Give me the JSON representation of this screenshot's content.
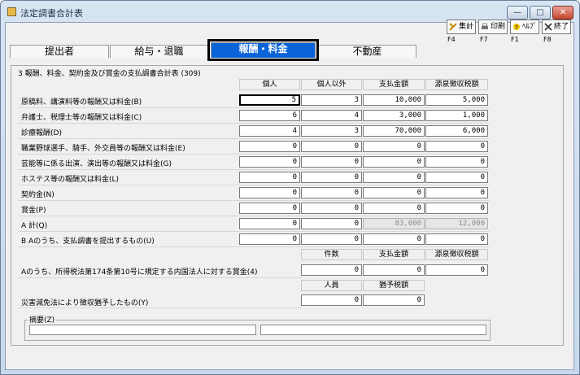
{
  "window": {
    "title": "法定調書合計表",
    "min": "—",
    "max": "□",
    "close": "✕"
  },
  "toolbar": [
    {
      "label": "集計",
      "fkey": "F4",
      "icon": "sum-icon"
    },
    {
      "label": "印刷",
      "fkey": "F7",
      "icon": "printer-icon"
    },
    {
      "label": "ﾍﾙﾌﾟ",
      "fkey": "F1",
      "icon": "help-icon"
    },
    {
      "label": "終了",
      "fkey": "F8",
      "icon": "exit-icon"
    }
  ],
  "tabs": [
    "提出者",
    "給与・退職",
    "報酬・料金",
    "不動産"
  ],
  "active_tab": "報酬・料金",
  "section_title": "3 報酬、料金、契約金及び賞金の支払調書合計表 (309)",
  "headers": [
    "個人",
    "個人以外",
    "支払金額",
    "源泉徴収税額"
  ],
  "rows": [
    {
      "label": "原稿料、講演料等の報酬又は料金(B)",
      "values": [
        "5",
        "3",
        "10,000",
        "5,000"
      ]
    },
    {
      "label": "弁護士、税理士等の報酬又は料金(C)",
      "values": [
        "6",
        "4",
        "3,000",
        "1,000"
      ]
    },
    {
      "label": "診療報酬(D)",
      "values": [
        "4",
        "3",
        "70,000",
        "6,000"
      ]
    },
    {
      "label": "職業野球選手、騎手、外交員等の報酬又は料金(E)",
      "values": [
        "0",
        "0",
        "0",
        "0"
      ]
    },
    {
      "label": "芸能等に係る出演、演出等の報酬又は料金(G)",
      "values": [
        "0",
        "0",
        "0",
        "0"
      ]
    },
    {
      "label": "ホステス等の報酬又は料金(L)",
      "values": [
        "0",
        "0",
        "0",
        "0"
      ]
    },
    {
      "label": "契約金(N)",
      "values": [
        "0",
        "0",
        "0",
        "0"
      ]
    },
    {
      "label": "賞金(P)",
      "values": [
        "0",
        "0",
        "0",
        "0"
      ]
    },
    {
      "label": "A 計(Q)",
      "values": [
        "0",
        "0",
        "83,000",
        "12,000"
      ]
    },
    {
      "label": "B Aのうち、支払調書を提出するもの(U)",
      "values": [
        "0",
        "0",
        "0",
        "0"
      ]
    }
  ],
  "sub1": {
    "headers": [
      "件数",
      "支払金額",
      "源泉徴収税額"
    ],
    "label": "Aのうち、所得税法第174条第10号に規定する内国法人に対する賞金(4)",
    "values": [
      "0",
      "0",
      "0"
    ]
  },
  "sub2": {
    "headers": [
      "人員",
      "猶予税額"
    ],
    "label": "災害減免法により徴収猶予したもの(Y)",
    "values": [
      "0",
      "0"
    ]
  },
  "memo_label": "摘要(Z)",
  "colors": {
    "active_tab": "#0a64d8",
    "window": "#d7e4f2",
    "client": "#f0f0f0"
  }
}
